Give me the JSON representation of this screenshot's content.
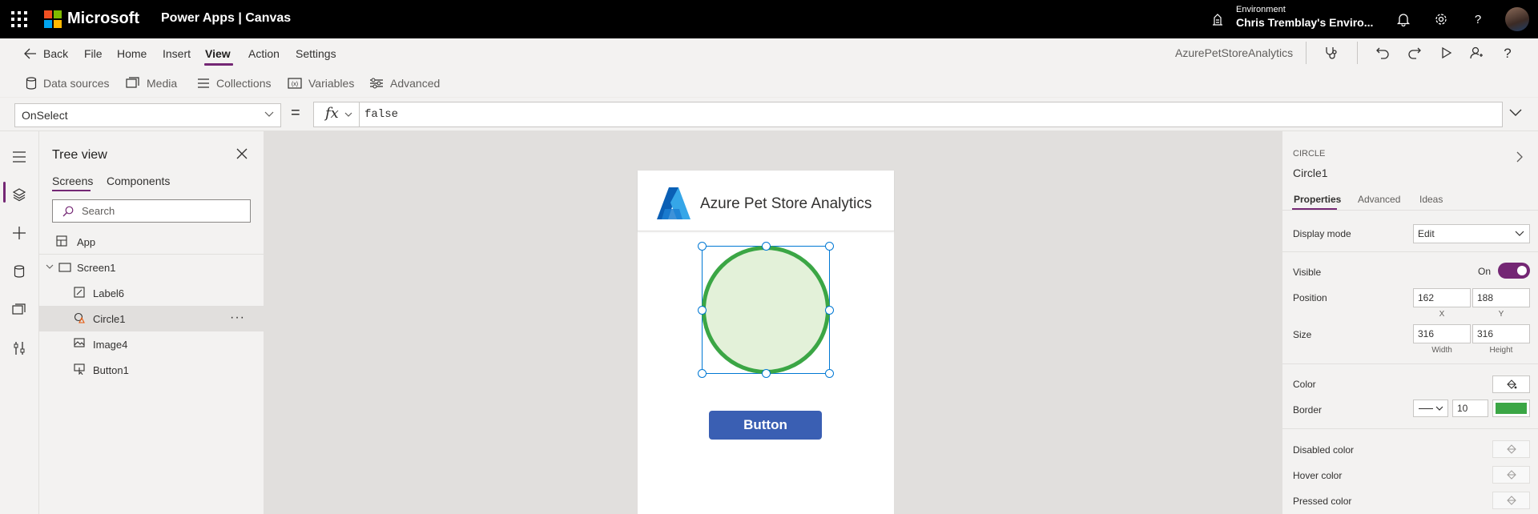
{
  "topbar": {
    "brand": "Microsoft",
    "product": "Power Apps  |  Canvas",
    "environment_label": "Environment",
    "environment_name": "Chris Tremblay's Enviro..."
  },
  "menu": {
    "back": "Back",
    "items": [
      "File",
      "Home",
      "Insert",
      "View",
      "Action",
      "Settings"
    ],
    "active": "View",
    "app_name": "AzurePetStoreAnalytics"
  },
  "view_toolbar": {
    "items": [
      "Data sources",
      "Media",
      "Collections",
      "Variables",
      "Advanced"
    ]
  },
  "formula_bar": {
    "property": "OnSelect",
    "equals": "=",
    "fx": "fx",
    "formula": "false"
  },
  "tree": {
    "title": "Tree view",
    "tabs": [
      "Screens",
      "Components"
    ],
    "search_placeholder": "Search",
    "app": "App",
    "screen": "Screen1",
    "children": [
      "Label6",
      "Circle1",
      "Image4",
      "Button1"
    ],
    "selected": "Circle1",
    "more": "···"
  },
  "canvas": {
    "app_title": "Azure Pet Store Analytics",
    "button_label": "Button",
    "circle_fill": "#e3f1d9",
    "circle_border": "#3ba645",
    "button_color": "#3a5fb3"
  },
  "props": {
    "type": "CIRCLE",
    "name": "Circle1",
    "tabs": [
      "Properties",
      "Advanced",
      "Ideas"
    ],
    "display_mode_label": "Display mode",
    "display_mode_value": "Edit",
    "visible_label": "Visible",
    "visible_value": "On",
    "position_label": "Position",
    "x": "162",
    "y": "188",
    "x_caption": "X",
    "y_caption": "Y",
    "size_label": "Size",
    "width": "316",
    "height": "316",
    "width_caption": "Width",
    "height_caption": "Height",
    "color_label": "Color",
    "border_label": "Border",
    "border_width": "10",
    "disabled_color_label": "Disabled color",
    "hover_color_label": "Hover color",
    "pressed_color_label": "Pressed color"
  },
  "colors": {
    "accent": "#742774",
    "selection": "#0078d4"
  }
}
